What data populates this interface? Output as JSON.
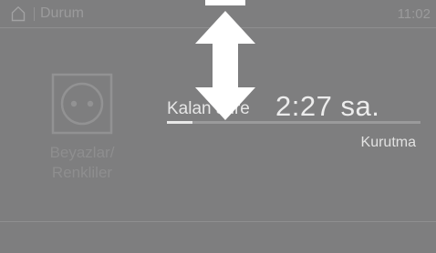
{
  "statusbar": {
    "title": "Durum",
    "time": "11:02",
    "home_icon": "home-icon"
  },
  "program": {
    "icon": "wash-program-icon",
    "label_line1": "Beyazlar/",
    "label_line2": "Renkliler"
  },
  "remaining": {
    "label": "Kalan süre",
    "value": "2:27 sa.",
    "progress_fraction": 0.1,
    "phase": "Kurutma"
  },
  "overlay": {
    "gesture_icon": "swipe-up-down-arrow-icon"
  },
  "colors": {
    "background": "#7e7e7f",
    "foreground": "#ececec",
    "dim_text": "#9b9b9c",
    "accent": "#ffffff"
  }
}
